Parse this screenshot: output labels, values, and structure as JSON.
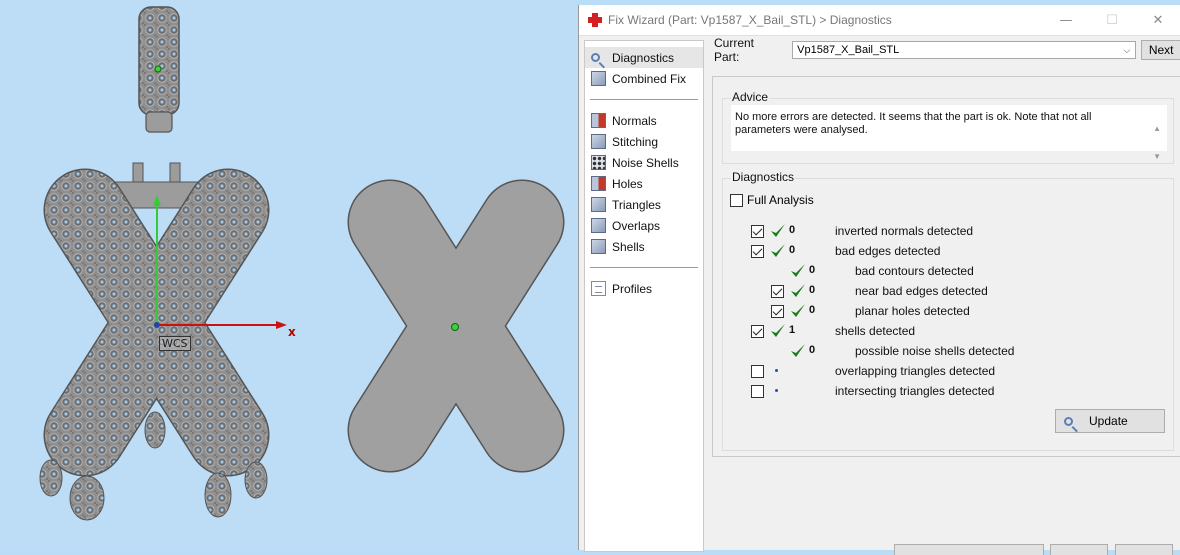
{
  "viewport": {
    "axis_x_label": "x",
    "wcs_label": "WCS"
  },
  "window": {
    "title": "Fix Wizard (Part: Vp1587_X_Bail_STL) > Diagnostics",
    "controls": {
      "minimize": "—",
      "maximize": "☐",
      "close": "✕"
    }
  },
  "nav": {
    "top_items": [
      {
        "label": "Diagnostics",
        "icon": "magnifier-icon",
        "selected": true
      },
      {
        "label": "Combined Fix",
        "icon": "cube-icon"
      }
    ],
    "fix_items": [
      {
        "label": "Normals",
        "icon": "normals-cube-icon"
      },
      {
        "label": "Stitching",
        "icon": "stitching-cube-icon"
      },
      {
        "label": "Noise Shells",
        "icon": "noise-shells-icon"
      },
      {
        "label": "Holes",
        "icon": "holes-cube-icon"
      },
      {
        "label": "Triangles",
        "icon": "triangles-cube-icon"
      },
      {
        "label": "Overlaps",
        "icon": "overlaps-cube-icon"
      },
      {
        "label": "Shells",
        "icon": "shells-cube-icon"
      }
    ],
    "bottom_items": [
      {
        "label": "Profiles",
        "icon": "document-icon"
      }
    ]
  },
  "current_part": {
    "label": "Current Part:",
    "value": "Vp1587_X_Bail_STL",
    "next_label": "Next"
  },
  "advice": {
    "title": "Advice",
    "text": "No more errors are detected. It seems that the part is ok. Note that not all parameters were analysed."
  },
  "diagnostics": {
    "title": "Diagnostics",
    "full_analysis_label": "Full Analysis",
    "full_analysis_checked": false,
    "rows": [
      {
        "indent": 0,
        "checkbox": true,
        "checked": true,
        "mark": "check",
        "count": "0",
        "text": "inverted normals detected"
      },
      {
        "indent": 0,
        "checkbox": true,
        "checked": true,
        "mark": "check",
        "count": "0",
        "text": "bad edges detected"
      },
      {
        "indent": 1,
        "checkbox": false,
        "checked": false,
        "mark": "check",
        "count": "0",
        "text": "bad contours detected"
      },
      {
        "indent": 1,
        "checkbox": true,
        "checked": true,
        "mark": "check",
        "count": "0",
        "text": "near bad edges detected"
      },
      {
        "indent": 1,
        "checkbox": true,
        "checked": true,
        "mark": "check",
        "count": "0",
        "text": "planar holes detected"
      },
      {
        "indent": 0,
        "checkbox": true,
        "checked": true,
        "mark": "check",
        "count": "1",
        "text": "shells detected"
      },
      {
        "indent": 1,
        "checkbox": false,
        "checked": false,
        "mark": "check",
        "count": "0",
        "text": "possible noise shells detected"
      },
      {
        "indent": 0,
        "checkbox": true,
        "checked": false,
        "mark": "dot",
        "count": "",
        "text": "overlapping triangles detected"
      },
      {
        "indent": 0,
        "checkbox": true,
        "checked": false,
        "mark": "dot",
        "count": "",
        "text": "intersecting triangles detected"
      }
    ],
    "update_label": "Update"
  },
  "colors": {
    "viewport_bg": "#bddcf6",
    "part_gray": "#a0a0a0",
    "check_green": "#1a7a1a",
    "axis_red": "#cc1111",
    "axis_green": "#33cc33",
    "title_icon_red": "#d42020"
  }
}
